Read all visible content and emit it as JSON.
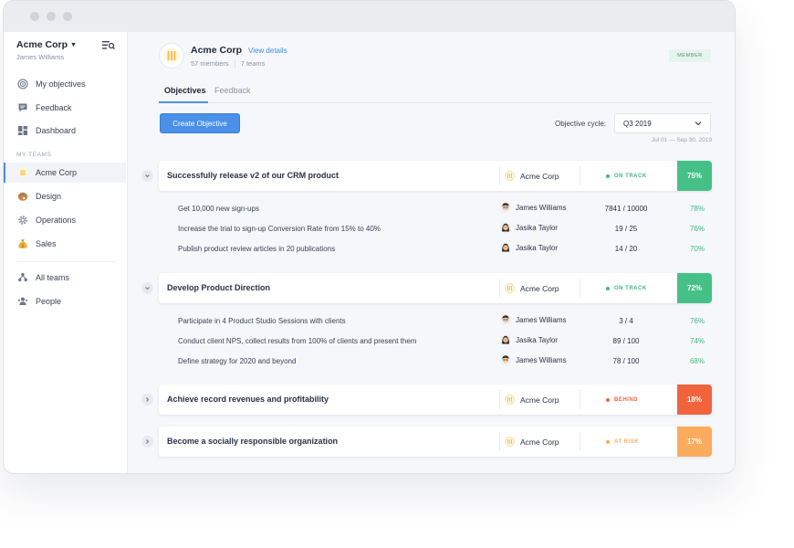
{
  "sidebar": {
    "org_name": "Acme Corp",
    "user_name": "James Williams",
    "nav": [
      {
        "label": "My objectives",
        "icon": "target-icon"
      },
      {
        "label": "Feedback",
        "icon": "chat-icon"
      },
      {
        "label": "Dashboard",
        "icon": "dashboard-icon"
      }
    ],
    "section_label": "MY TEAMS",
    "teams": [
      {
        "label": "Acme Corp",
        "icon": "acme-logo-icon"
      },
      {
        "label": "Design",
        "icon": "palette-icon"
      },
      {
        "label": "Operations",
        "icon": "gear-icon"
      },
      {
        "label": "Sales",
        "icon": "money-bag-icon"
      }
    ],
    "bottom": [
      {
        "label": "All teams",
        "icon": "teams-icon"
      },
      {
        "label": "People",
        "icon": "people-icon"
      }
    ]
  },
  "header": {
    "team_name": "Acme Corp",
    "view_details": "View details",
    "members": "57 members",
    "teams_count": "7 teams",
    "role_badge": "MEMBER"
  },
  "tabs": [
    "Objectives",
    "Feedback"
  ],
  "toolbar": {
    "create_label": "Create Objective",
    "cycle_label": "Objective cycle:",
    "cycle_value": "Q3 2019",
    "cycle_range": "Jul 01 — Sep 30, 2019"
  },
  "colors": {
    "accent": "#4a90e8",
    "on_track": "#3fb87e",
    "behind": "#f0643c",
    "at_risk": "#fbab5c"
  },
  "objectives": [
    {
      "title": "Successfully release v2 of our CRM product",
      "team": "Acme Corp",
      "status": "ON TRACK",
      "status_color": "#3fb87e",
      "percent": "75%",
      "expanded": true,
      "key_results": [
        {
          "title": "Get 10,000 new sign-ups",
          "owner": "James Williams",
          "progress": "7841 / 10000",
          "percent": "78%"
        },
        {
          "title": "Increase the trial to sign-up Conversion Rate from 15% to 40%",
          "owner": "Jasika Taylor",
          "progress": "19 / 25",
          "percent": "76%"
        },
        {
          "title": "Publish product review articles in 20 publications",
          "owner": "Jasika Taylor",
          "progress": "14 / 20",
          "percent": "70%"
        }
      ]
    },
    {
      "title": "Develop Product Direction",
      "team": "Acme Corp",
      "status": "ON TRACK",
      "status_color": "#3fb87e",
      "percent": "72%",
      "expanded": true,
      "key_results": [
        {
          "title": "Participate in 4 Product Studio Sessions with clients",
          "owner": "James Williams",
          "progress": "3 / 4",
          "percent": "76%"
        },
        {
          "title": "Conduct client NPS, collect results from 100% of clients and present them",
          "owner": "Jasika Taylor",
          "progress": "89 / 100",
          "percent": "74%"
        },
        {
          "title": "Define strategy for 2020 and beyond",
          "owner": "James Williams",
          "progress": "78 / 100",
          "percent": "68%"
        }
      ]
    },
    {
      "title": "Achieve record revenues and profitability",
      "team": "Acme Corp",
      "status": "BEHIND",
      "status_color": "#f0643c",
      "percent": "18%",
      "expanded": false,
      "key_results": []
    },
    {
      "title": "Become a socially responsible organization",
      "team": "Acme Corp",
      "status": "AT RISK",
      "status_color": "#fbab5c",
      "percent": "17%",
      "expanded": false,
      "key_results": []
    }
  ]
}
